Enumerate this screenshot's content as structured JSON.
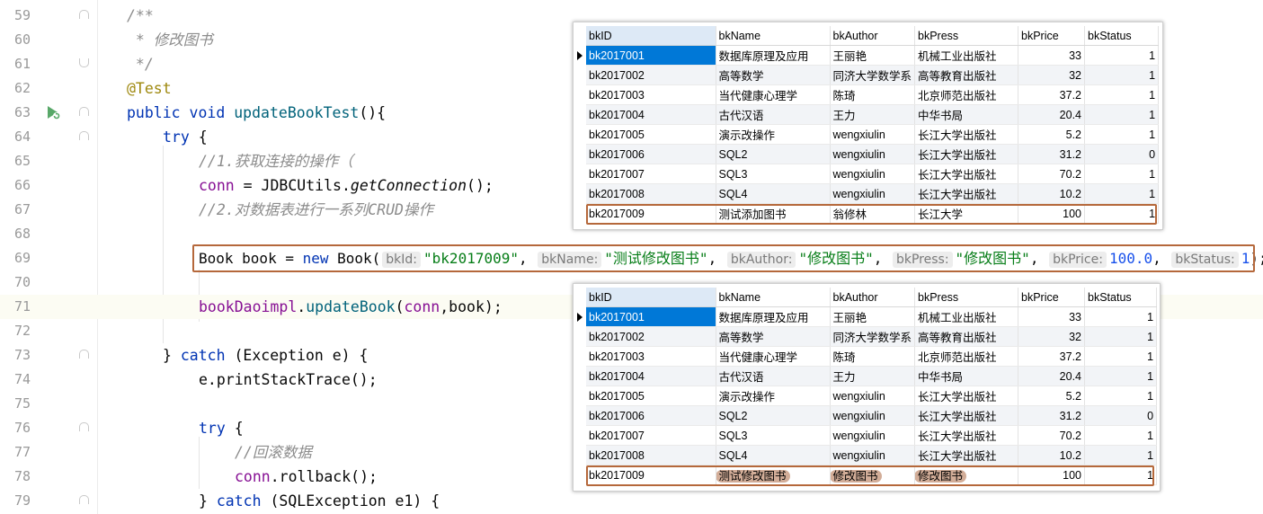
{
  "editor": {
    "lines": [
      {
        "num": "59"
      },
      {
        "num": "60"
      },
      {
        "num": "61"
      },
      {
        "num": "62"
      },
      {
        "num": "63"
      },
      {
        "num": "64"
      },
      {
        "num": "65"
      },
      {
        "num": "66"
      },
      {
        "num": "67"
      },
      {
        "num": "68"
      },
      {
        "num": "69"
      },
      {
        "num": "70"
      },
      {
        "num": "71"
      },
      {
        "num": "72"
      },
      {
        "num": "73"
      },
      {
        "num": "74"
      },
      {
        "num": "75"
      },
      {
        "num": "76"
      },
      {
        "num": "77"
      },
      {
        "num": "78"
      },
      {
        "num": "79"
      }
    ],
    "code": {
      "l59": "/**",
      "l60": " * 修改图书",
      "l61": " */",
      "l62": "@Test",
      "l63_kw1": "public",
      "l63_kw2": "void",
      "l63_fn": "updateBookTest",
      "l63_rest": "(){",
      "l64_kw": "try",
      "l64_rest": " {",
      "l65": "//1.获取连接的操作（",
      "l66_var": "conn",
      "l66_mid": " = JDBCUtils.",
      "l66_call": "getConnection",
      "l66_end": "();",
      "l67": "//2.对数据表进行一系列CRUD操作",
      "l69_a": "Book book = ",
      "l69_new": "new",
      "l69_b": " Book(",
      "l69_h1": "bkId:",
      "l69_v1": "\"bk2017009\"",
      "l69_h2": "bkName:",
      "l69_v2": "\"测试修改图书\"",
      "l69_h3": "bkAuthor:",
      "l69_v3": "\"修改图书\"",
      "l69_h4": "bkPress:",
      "l69_v4": "\"修改图书\"",
      "l69_h5": "bkPrice:",
      "l69_v5": "100.0",
      "l69_h6": "bkStatus:",
      "l69_v6": "1",
      "l69_end": ");",
      "comma": ", ",
      "l71_fld": "bookDaoimpl",
      "l71_dot": ".",
      "l71_call": "updateBook",
      "l71_open": "(",
      "l71_conn": "conn",
      "l71_rest": ",book);",
      "l73_a": "} ",
      "l73_kw": "catch",
      "l73_b": " (Exception e) {",
      "l74": "e.printStackTrace();",
      "l76_kw": "try",
      "l76_rest": " {",
      "l77": "//回滚数据",
      "l78_var": "conn",
      "l78_rest": ".rollback();",
      "l79_a": "} ",
      "l79_kw": "catch",
      "l79_b": " (SQLException e1) {"
    }
  },
  "table_top": {
    "columns": [
      "bkID",
      "bkName",
      "bkAuthor",
      "bkPress",
      "bkPrice",
      "bkStatus"
    ],
    "rows": [
      [
        "bk2017001",
        "数据库原理及应用",
        "王丽艳",
        "机械工业出版社",
        "33",
        "1"
      ],
      [
        "bk2017002",
        "高等数学",
        "同济大学数学系",
        "高等教育出版社",
        "32",
        "1"
      ],
      [
        "bk2017003",
        "当代健康心理学",
        "陈琦",
        "北京师范出版社",
        "37.2",
        "1"
      ],
      [
        "bk2017004",
        "古代汉语",
        "王力",
        "中华书局",
        "20.4",
        "1"
      ],
      [
        "bk2017005",
        "演示改操作",
        "wengxiulin",
        "长江大学出版社",
        "5.2",
        "1"
      ],
      [
        "bk2017006",
        "SQL2",
        "wengxiulin",
        "长江大学出版社",
        "31.2",
        "0"
      ],
      [
        "bk2017007",
        "SQL3",
        "wengxiulin",
        "长江大学出版社",
        "70.2",
        "1"
      ],
      [
        "bk2017008",
        "SQL4",
        "wengxiulin",
        "长江大学出版社",
        "10.2",
        "1"
      ],
      [
        "bk2017009",
        "测试添加图书",
        "翁修林",
        "长江大学",
        "100",
        "1"
      ]
    ]
  },
  "table_bottom": {
    "columns": [
      "bkID",
      "bkName",
      "bkAuthor",
      "bkPress",
      "bkPrice",
      "bkStatus"
    ],
    "rows": [
      [
        "bk2017001",
        "数据库原理及应用",
        "王丽艳",
        "机械工业出版社",
        "33",
        "1"
      ],
      [
        "bk2017002",
        "高等数学",
        "同济大学数学系",
        "高等教育出版社",
        "32",
        "1"
      ],
      [
        "bk2017003",
        "当代健康心理学",
        "陈琦",
        "北京师范出版社",
        "37.2",
        "1"
      ],
      [
        "bk2017004",
        "古代汉语",
        "王力",
        "中华书局",
        "20.4",
        "1"
      ],
      [
        "bk2017005",
        "演示改操作",
        "wengxiulin",
        "长江大学出版社",
        "5.2",
        "1"
      ],
      [
        "bk2017006",
        "SQL2",
        "wengxiulin",
        "长江大学出版社",
        "31.2",
        "0"
      ],
      [
        "bk2017007",
        "SQL3",
        "wengxiulin",
        "长江大学出版社",
        "70.2",
        "1"
      ],
      [
        "bk2017008",
        "SQL4",
        "wengxiulin",
        "长江大学出版社",
        "10.2",
        "1"
      ],
      [
        "bk2017009",
        "测试修改图书",
        "修改图书",
        "修改图书",
        "100",
        "1"
      ]
    ]
  },
  "colors": {
    "highlight_border": "#b5683b",
    "selected_cell": "#0078d7",
    "keyword": "#0033b3",
    "string": "#067d17",
    "comment": "#8c8c8c",
    "annotation": "#9e880d"
  },
  "icons": {
    "run": "run-test-icon"
  }
}
